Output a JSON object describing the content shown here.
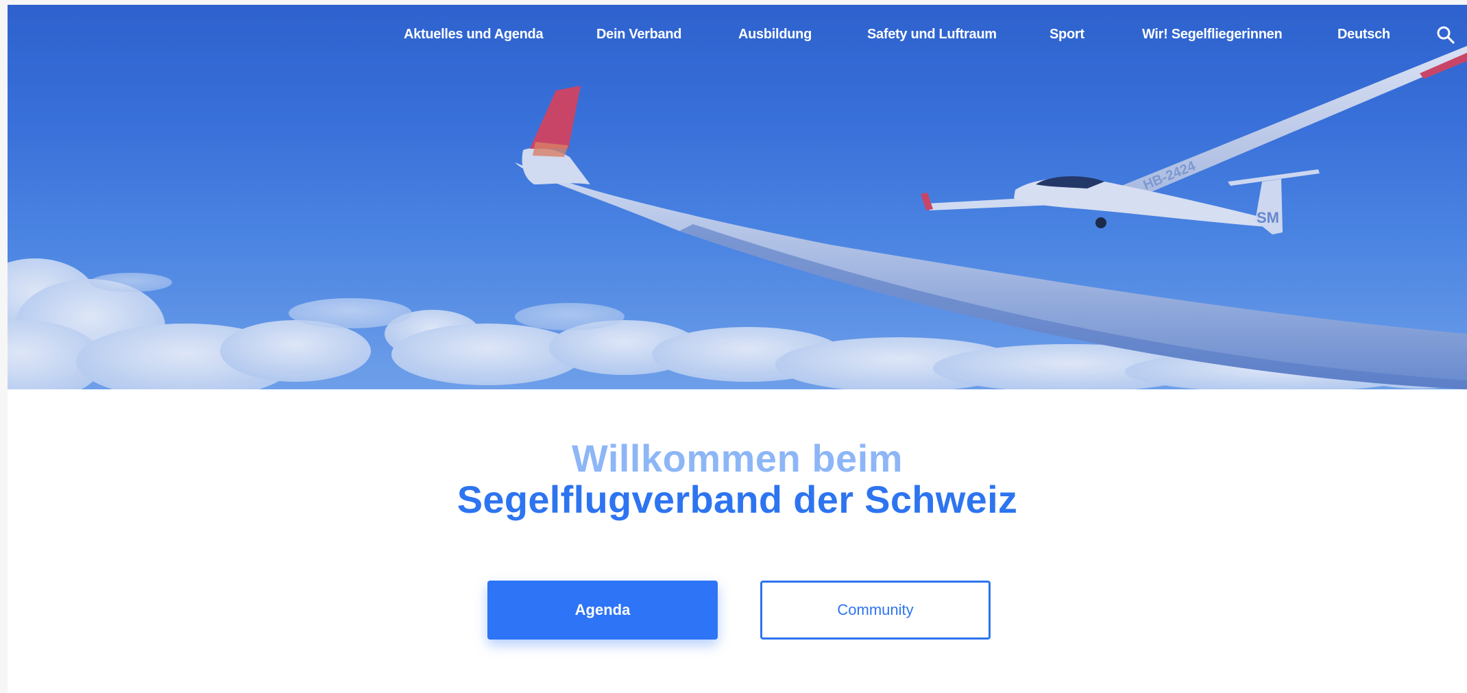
{
  "nav": {
    "items": [
      {
        "label": "Aktuelles und Agenda"
      },
      {
        "label": "Dein Verband"
      },
      {
        "label": "Ausbildung"
      },
      {
        "label": "Safety und Luftraum"
      },
      {
        "label": "Sport"
      },
      {
        "label": "Wir! Segelfliegerinnen"
      },
      {
        "label": "Deutsch"
      }
    ],
    "search_icon": "search-icon"
  },
  "hero": {
    "glider_registration": "HB-2424",
    "tail_marking": "SM"
  },
  "welcome": {
    "line1": "Willkommen beim",
    "line2": "Segelflugverband der Schweiz"
  },
  "buttons": {
    "agenda_label": "Agenda",
    "community_label": "Community"
  },
  "colors": {
    "primary": "#2d74f0",
    "primary_light": "#8db6f7",
    "hero_sky": "#3b73dc"
  }
}
